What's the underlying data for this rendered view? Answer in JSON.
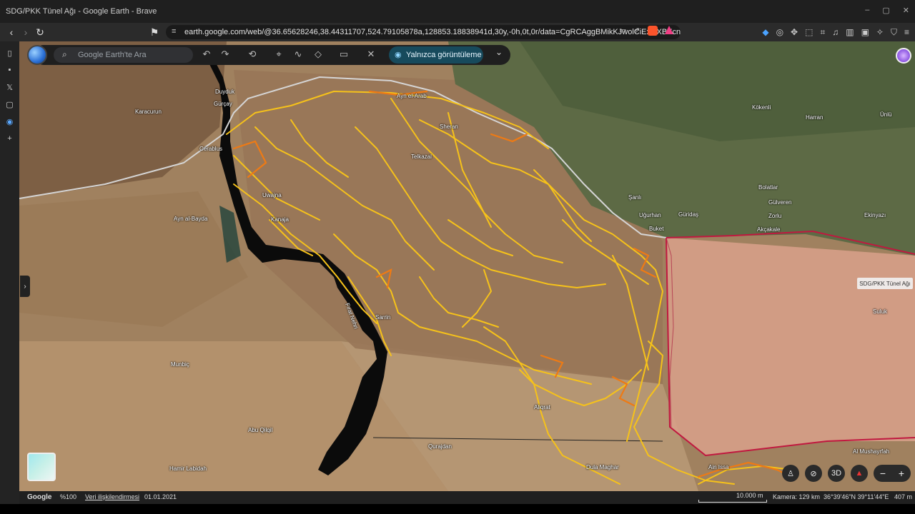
{
  "window": {
    "title": "SDG/PKK Tünel Ağı - Google Earth - Brave"
  },
  "browser": {
    "url": "earth.google.com/web/@36.65628246,38.44311707,524.79105878a,128853.18838941d,30y,-0h,0t,0r/data=CgRCAggBMikKJwolCiExOXBXcnRnN..."
  },
  "earth": {
    "search_placeholder": "Google Earth'te Ara",
    "view_only_label": "Yalnızca görüntüleme",
    "layer_name": "SDG/PKK Tünel Ağı",
    "map_labels": [
      {
        "id": "duyduk",
        "text": "Duyduk"
      },
      {
        "id": "gurcay",
        "text": "Gürçay"
      },
      {
        "id": "karacurun",
        "text": "Karacurun"
      },
      {
        "id": "cerablus",
        "text": "Cerablus"
      },
      {
        "id": "ayn-el-arab",
        "text": "Ayn el-Arab"
      },
      {
        "id": "sheran",
        "text": "Sheran"
      },
      {
        "id": "telkazal",
        "text": "Telkazal"
      },
      {
        "id": "uwajna",
        "text": "Uwajna"
      },
      {
        "id": "kanaja",
        "text": "Kanaja"
      },
      {
        "id": "ayn-al-bayda",
        "text": "Ayn al-Bayda"
      },
      {
        "id": "sarrin",
        "text": "Sarrin"
      },
      {
        "id": "firat-nehri",
        "text": "Fırat Nehri"
      },
      {
        "id": "munbic",
        "text": "Munbiç"
      },
      {
        "id": "abu-qilqil",
        "text": "Abu Qilqil"
      },
      {
        "id": "hamir-labidah",
        "text": "Hamir Labidah"
      },
      {
        "id": "aliqrat",
        "text": "Aliqrat"
      },
      {
        "id": "qurajdan",
        "text": "Qurajdan"
      },
      {
        "id": "dula-maghar",
        "text": "Dula Maghar"
      },
      {
        "id": "ain-issa",
        "text": "Ain Issa"
      },
      {
        "id": "kokenli",
        "text": "Kökenli"
      },
      {
        "id": "harran",
        "text": "Harran"
      },
      {
        "id": "unlu",
        "text": "Ünlü"
      },
      {
        "id": "sanli",
        "text": "Şanlı"
      },
      {
        "id": "bolatlar",
        "text": "Bolatlar"
      },
      {
        "id": "gulveren",
        "text": "Gülveren"
      },
      {
        "id": "zorlu",
        "text": "Zorlu"
      },
      {
        "id": "ugurhan",
        "text": "Uğurhan"
      },
      {
        "id": "guridas",
        "text": "Güridaş"
      },
      {
        "id": "buket",
        "text": "Buket"
      },
      {
        "id": "akcakale",
        "text": "Akçakale"
      },
      {
        "id": "ekinyazi",
        "text": "Ekinyazı"
      },
      {
        "id": "suluk",
        "text": "Suluk"
      },
      {
        "id": "al-mushayrfah",
        "text": "Al Mushayrfah"
      }
    ]
  },
  "status": {
    "google": "Google",
    "zoom": "%100",
    "data_attribution": "Veri ilişkilendirmesi",
    "date": "01.01.2021",
    "scale": "10.000 m",
    "camera": "Kamera: 129 km",
    "coords": "36°39'46\"N 39°11'44\"E",
    "elevation": "407 m"
  },
  "controls": {
    "three_d": "3D"
  },
  "colors": {
    "tunnel_yellow": "#f6c21a",
    "tunnel_orange": "#ee7a14",
    "border_red": "#c0183f",
    "border_gray": "#cfcfcf"
  }
}
